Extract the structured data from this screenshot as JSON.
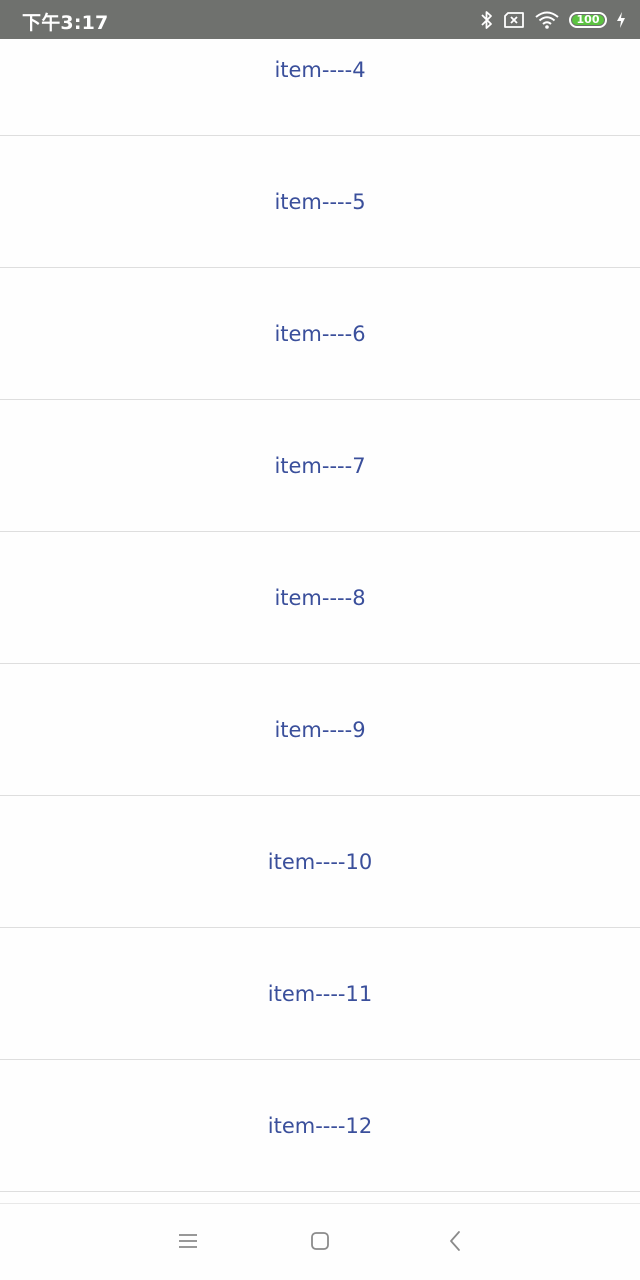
{
  "status_bar": {
    "time": "下午3:17",
    "battery_level": "100",
    "icons": [
      "bluetooth-icon",
      "no-sim-icon",
      "wifi-icon",
      "battery-icon",
      "charging-icon"
    ],
    "background_color": "#6f716e",
    "battery_color": "#5cc341"
  },
  "list": {
    "items": [
      {
        "label": "item----4"
      },
      {
        "label": "item----5"
      },
      {
        "label": "item----6"
      },
      {
        "label": "item----7"
      },
      {
        "label": "item----8"
      },
      {
        "label": "item----9"
      },
      {
        "label": "item----10"
      },
      {
        "label": "item----11"
      },
      {
        "label": "item----12"
      }
    ],
    "text_color": "#3a4f9b"
  },
  "nav_bar": {
    "icons": [
      "menu-icon",
      "home-icon",
      "back-icon"
    ]
  }
}
